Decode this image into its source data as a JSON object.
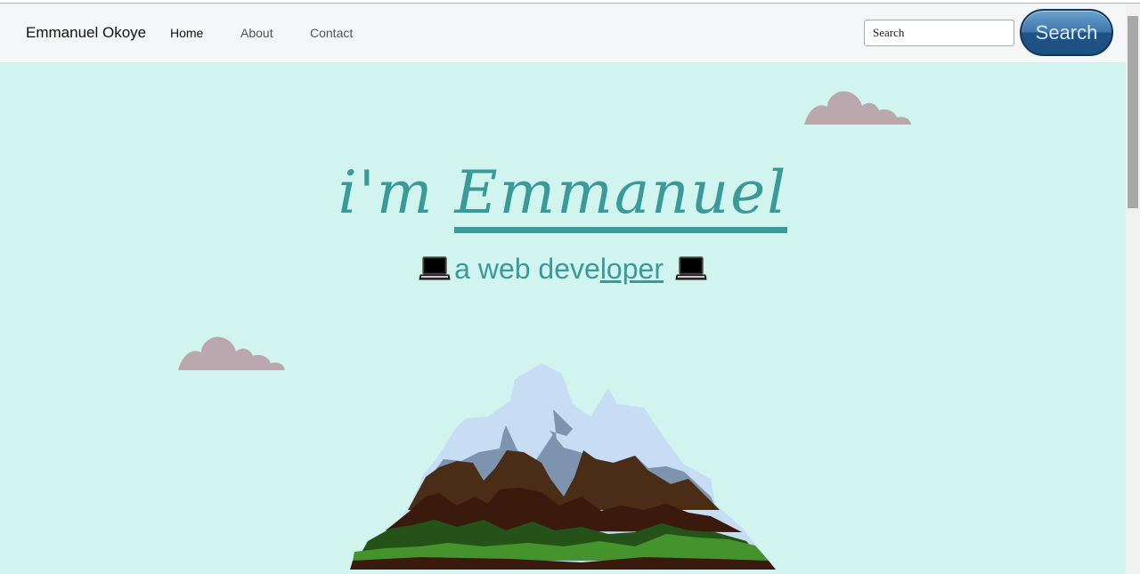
{
  "navbar": {
    "brand": "Emmanuel Okoye",
    "links": [
      {
        "label": "Home",
        "active": true
      },
      {
        "label": "About",
        "active": false
      },
      {
        "label": "Contact",
        "active": false
      }
    ],
    "search": {
      "placeholder": "Search",
      "button_label": "Search"
    }
  },
  "hero": {
    "title_prefix": "i'm ",
    "title_name": "Emmanuel",
    "subtitle_start": "a web deve",
    "subtitle_underlined": "loper",
    "left_icon": "laptop-icon",
    "right_icon": "laptop-icon"
  },
  "colors": {
    "background": "#d1f5ee",
    "accent": "#3a9a9a",
    "cloud": "#bba8ae",
    "navbar": "#f5f6f8",
    "button": "#2a5f93"
  }
}
